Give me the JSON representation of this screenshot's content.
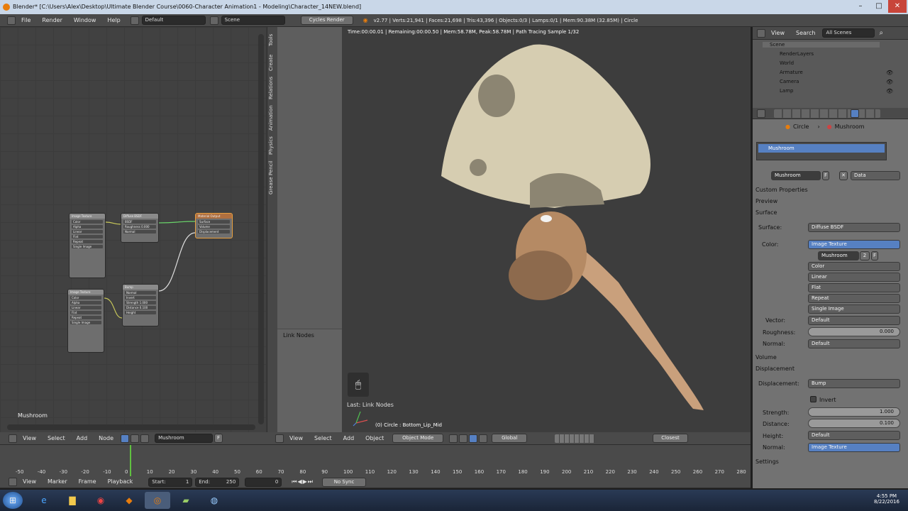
{
  "window": {
    "title": "Blender* [C:\\Users\\Alex\\Desktop\\Ultimate Blender Course\\0060-Character Animation1 - Modeling\\Character_14NEW.blend]"
  },
  "info_header": {
    "menus": [
      "File",
      "Render",
      "Window",
      "Help"
    ],
    "screen_layout": "Default",
    "scene": "Scene",
    "render_engine": "Cycles Render",
    "stats": "v2.77 | Verts:21,941 | Faces:21,698 | Tris:43,396 | Objects:0/3 | Lamps:0/1 | Mem:90.38M (32.85M) | Circle"
  },
  "node_editor": {
    "label": "Mushroom",
    "nodes": [
      {
        "title": "Image Texture",
        "fields": [
          "Color",
          "Alpha",
          "Color",
          "Linear",
          "Flat",
          "Repeat",
          "Single Image",
          "Vector"
        ]
      },
      {
        "title": "Diffuse BSDF",
        "fields": [
          "BSDF",
          "Color",
          "Roughness 0.000",
          "Normal"
        ]
      },
      {
        "title": "Material Output",
        "fields": [
          "Surface",
          "Volume",
          "Displacement"
        ]
      },
      {
        "title": "Image Texture",
        "fields": [
          "Color",
          "Alpha",
          "Color",
          "Linear",
          "Flat",
          "Repeat",
          "Single Image",
          "Vector"
        ]
      },
      {
        "title": "Bump",
        "fields": [
          "Normal",
          "Invert",
          "Strength 1.000",
          "Distance 0.100",
          "Height",
          "Normal"
        ]
      }
    ],
    "header": {
      "menus": [
        "View",
        "Select",
        "Add",
        "Node"
      ],
      "material": "Mushroom",
      "fake_user": "F"
    }
  },
  "tool_shelf": {
    "tabs": [
      "Tools",
      "Create",
      "Relations",
      "Animation",
      "Physics",
      "Grease Pencil"
    ],
    "panel": "Link Nodes"
  },
  "viewport": {
    "render_status": "Time:00:00.01 | Remaining:00:00.50 | Mem:58.78M, Peak:58.78M | Path Tracing Sample 1/32",
    "last_op": "Last: Link Nodes",
    "object_info": "(0) Circle : Bottom_Lip_Mid",
    "header": {
      "menus": [
        "View",
        "Select",
        "Add",
        "Object"
      ],
      "mode": "Object Mode",
      "orientation": "Global",
      "snap": "Closest"
    }
  },
  "outliner": {
    "menus": [
      "View",
      "Search"
    ],
    "filter": "All Scenes",
    "items": [
      "Scene",
      "RenderLayers",
      "World",
      "Armature",
      "Camera",
      "Lamp"
    ]
  },
  "properties": {
    "breadcrumb": [
      "Circle",
      "Mushroom"
    ],
    "material_slot": "Mushroom",
    "material_name": "Mushroom",
    "fake_user": "F",
    "link": "Data",
    "sections": {
      "custom": "Custom Properties",
      "preview": "Preview",
      "surface": "Surface",
      "volume": "Volume",
      "displacement": "Displacement",
      "settings": "Settings"
    },
    "surface": {
      "surface_label": "Surface:",
      "surface_value": "Diffuse BSDF",
      "color_label": "Color:",
      "color_value": "Image Texture",
      "image_name": "Mushroom",
      "image_users": "2",
      "image_fake": "F",
      "options": [
        "Color",
        "Linear",
        "Flat",
        "Repeat",
        "Single Image"
      ],
      "vector_label": "Vector:",
      "vector_value": "Default",
      "roughness_label": "Roughness:",
      "roughness_value": "0.000",
      "normal_label": "Normal:",
      "normal_value": "Default"
    },
    "displacement": {
      "label": "Displacement:",
      "value": "Bump",
      "invert": "Invert",
      "strength_label": "Strength:",
      "strength_value": "1.000",
      "distance_label": "Distance:",
      "distance_value": "0.100",
      "height_label": "Height:",
      "height_value": "Default",
      "normal_label": "Normal:",
      "normal_value": "Image Texture"
    }
  },
  "timeline": {
    "ticks": [
      "-50",
      "-40",
      "-30",
      "-20",
      "-10",
      "0",
      "10",
      "20",
      "30",
      "40",
      "50",
      "60",
      "70",
      "80",
      "90",
      "100",
      "110",
      "120",
      "130",
      "140",
      "150",
      "160",
      "170",
      "180",
      "190",
      "200",
      "210",
      "220",
      "230",
      "240",
      "250",
      "260",
      "270",
      "280"
    ],
    "header": {
      "menus": [
        "View",
        "Marker",
        "Frame",
        "Playback"
      ],
      "start": "Start:",
      "start_value": "1",
      "end": "End:",
      "end_value": "250",
      "current": "0",
      "sync": "No Sync"
    }
  },
  "taskbar": {
    "time": "4:55 PM",
    "date": "8/22/2016"
  },
  "colors": {
    "accent_blue": "#5680c2",
    "title_bar": "#c9d7e8",
    "current_frame": "#60c040"
  }
}
